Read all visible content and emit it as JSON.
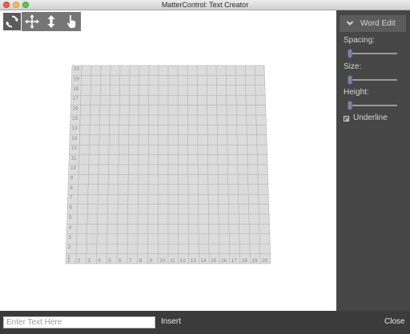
{
  "window": {
    "title": "MatterControl: Text Creator"
  },
  "toolbar": {
    "tools": [
      {
        "icon": "rotate-icon",
        "active": true
      },
      {
        "icon": "move-icon",
        "active": false
      },
      {
        "icon": "move-vertical-icon",
        "active": false
      },
      {
        "icon": "hand-pointer-icon",
        "active": false
      }
    ]
  },
  "bed": {
    "x_labels": [
      "1",
      "2",
      "3",
      "4",
      "5",
      "6",
      "7",
      "8",
      "9",
      "10",
      "11",
      "12",
      "13",
      "14",
      "15",
      "16",
      "17",
      "18",
      "19",
      "20"
    ],
    "y_labels": [
      "1",
      "2",
      "3",
      "4",
      "5",
      "6",
      "7",
      "8",
      "9",
      "10",
      "11",
      "12",
      "13",
      "14",
      "15",
      "16",
      "17",
      "18",
      "19",
      "20"
    ],
    "grid_color": "#a9a9a9",
    "surface_color": "#dcdcdc"
  },
  "panel": {
    "section_label": "Word Edit",
    "spacing_label": "Spacing:",
    "size_label": "Size:",
    "height_label": "Height:",
    "spacing_value": 0,
    "size_value": 0,
    "height_value": 0,
    "underline_label": "Underline",
    "underline_checked": true
  },
  "bottom": {
    "input_placeholder": "Enter Text Here",
    "input_value": "",
    "insert_label": "Insert",
    "close_label": "Close"
  },
  "colors": {
    "panel_bg": "#464646",
    "bottom_bg": "#3b3b3b",
    "toolbar_bg": "#767676",
    "slider_thumb": "#7b82a4"
  }
}
